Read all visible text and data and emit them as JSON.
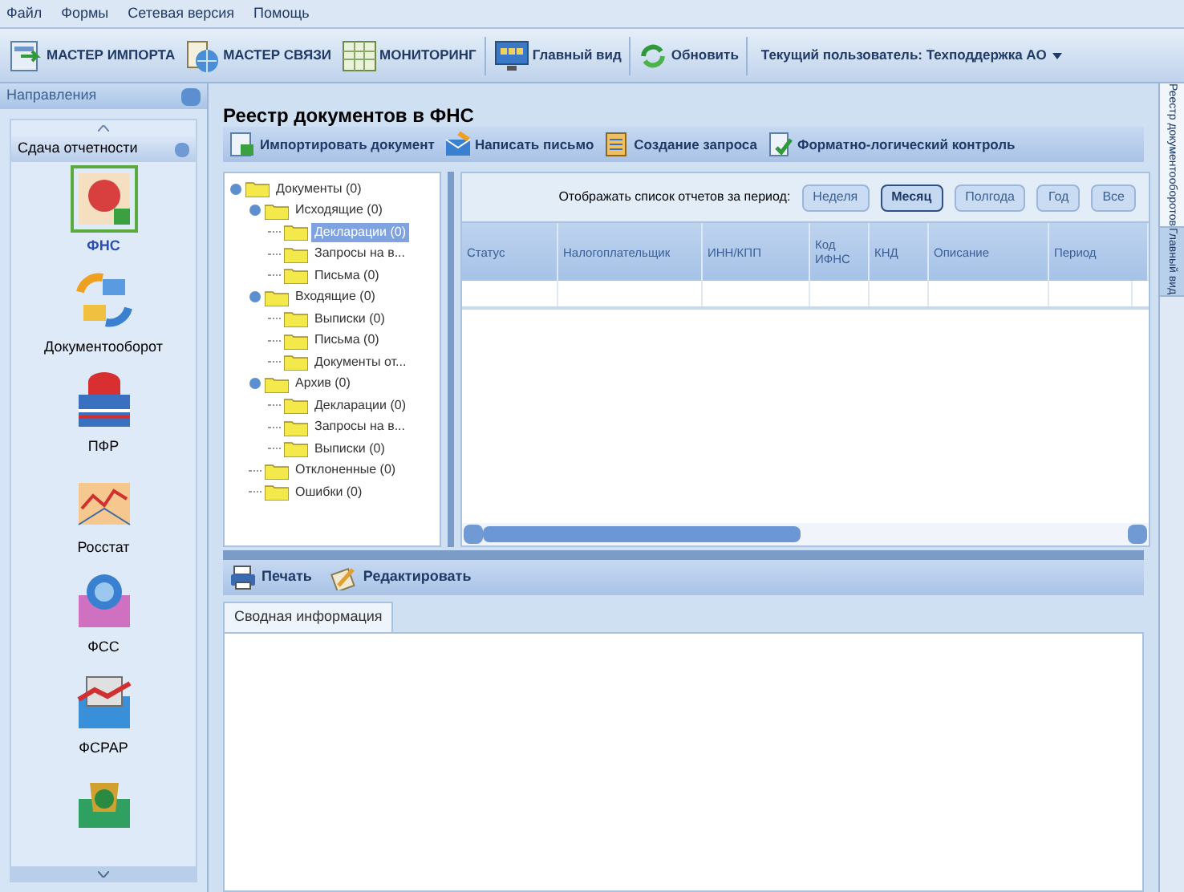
{
  "menu": [
    "Файл",
    "Формы",
    "Сетевая версия",
    "Помощь"
  ],
  "toolbar": [
    {
      "label": "МАСТЕР ИМПОРТА"
    },
    {
      "label": "МАСТЕР СВЯЗИ"
    },
    {
      "label": "МОНИТОРИНГ"
    },
    {
      "label": "Главный вид"
    },
    {
      "label": "Обновить"
    }
  ],
  "current_user": "Текущий пользователь: Техподдержка АО",
  "sidebar": {
    "title": "Направления",
    "group": "Сдача отчетности",
    "items": [
      {
        "label": "ФНС",
        "selected": true
      },
      {
        "label": "Документооборот",
        "selected": false
      },
      {
        "label": "ПФР",
        "selected": false
      },
      {
        "label": "Росстат",
        "selected": false
      },
      {
        "label": "ФСС",
        "selected": false
      },
      {
        "label": "ФСРАР",
        "selected": false
      },
      {
        "selected": false
      }
    ]
  },
  "page_title": "Реестр документов в ФНС",
  "actions": [
    "Импортировать документ",
    "Написать письмо",
    "Создание запроса",
    "Форматно-логический контроль"
  ],
  "tree": [
    {
      "label": "Документы (0)",
      "selected": false,
      "children": [
        {
          "label": "Исходящие (0)",
          "selected": false,
          "children": [
            {
              "label": "Декларации (0)",
              "selected": true
            },
            {
              "label": "Запросы на в...",
              "selected": false
            },
            {
              "label": "Письма (0)",
              "selected": false
            }
          ]
        },
        {
          "label": "Входящие (0)",
          "selected": false,
          "children": [
            {
              "label": "Выписки (0)",
              "selected": false
            },
            {
              "label": "Письма (0)",
              "selected": false
            },
            {
              "label": "Документы от...",
              "selected": false
            }
          ]
        },
        {
          "label": "Архив (0)",
          "selected": false,
          "children": [
            {
              "label": "Декларации (0)",
              "selected": false
            },
            {
              "label": "Запросы на в...",
              "selected": false
            },
            {
              "label": "Выписки (0)",
              "selected": false
            }
          ]
        },
        {
          "label": "Отклоненные (0)",
          "selected": false
        },
        {
          "label": "Ошибки (0)",
          "selected": false
        }
      ]
    }
  ],
  "period_label": "Отображать список отчетов за период:",
  "periods": [
    {
      "label": "Неделя",
      "selected": false
    },
    {
      "label": "Месяц",
      "selected": true
    },
    {
      "label": "Полгода",
      "selected": false
    },
    {
      "label": "Год",
      "selected": false
    },
    {
      "label": "Все",
      "selected": false
    }
  ],
  "table": {
    "columns": [
      "Статус",
      "Налогоплательщик",
      "ИНН/КПП",
      "Код ИФНС",
      "КНД",
      "Описание",
      "Период"
    ]
  },
  "bottom_actions": [
    "Печать",
    "Редактировать"
  ],
  "bottom_tab": "Сводная информация",
  "side_tabs": [
    {
      "label": "Реестр документооборотов",
      "selected": true
    },
    {
      "label": "Главный вид",
      "selected": false
    }
  ]
}
